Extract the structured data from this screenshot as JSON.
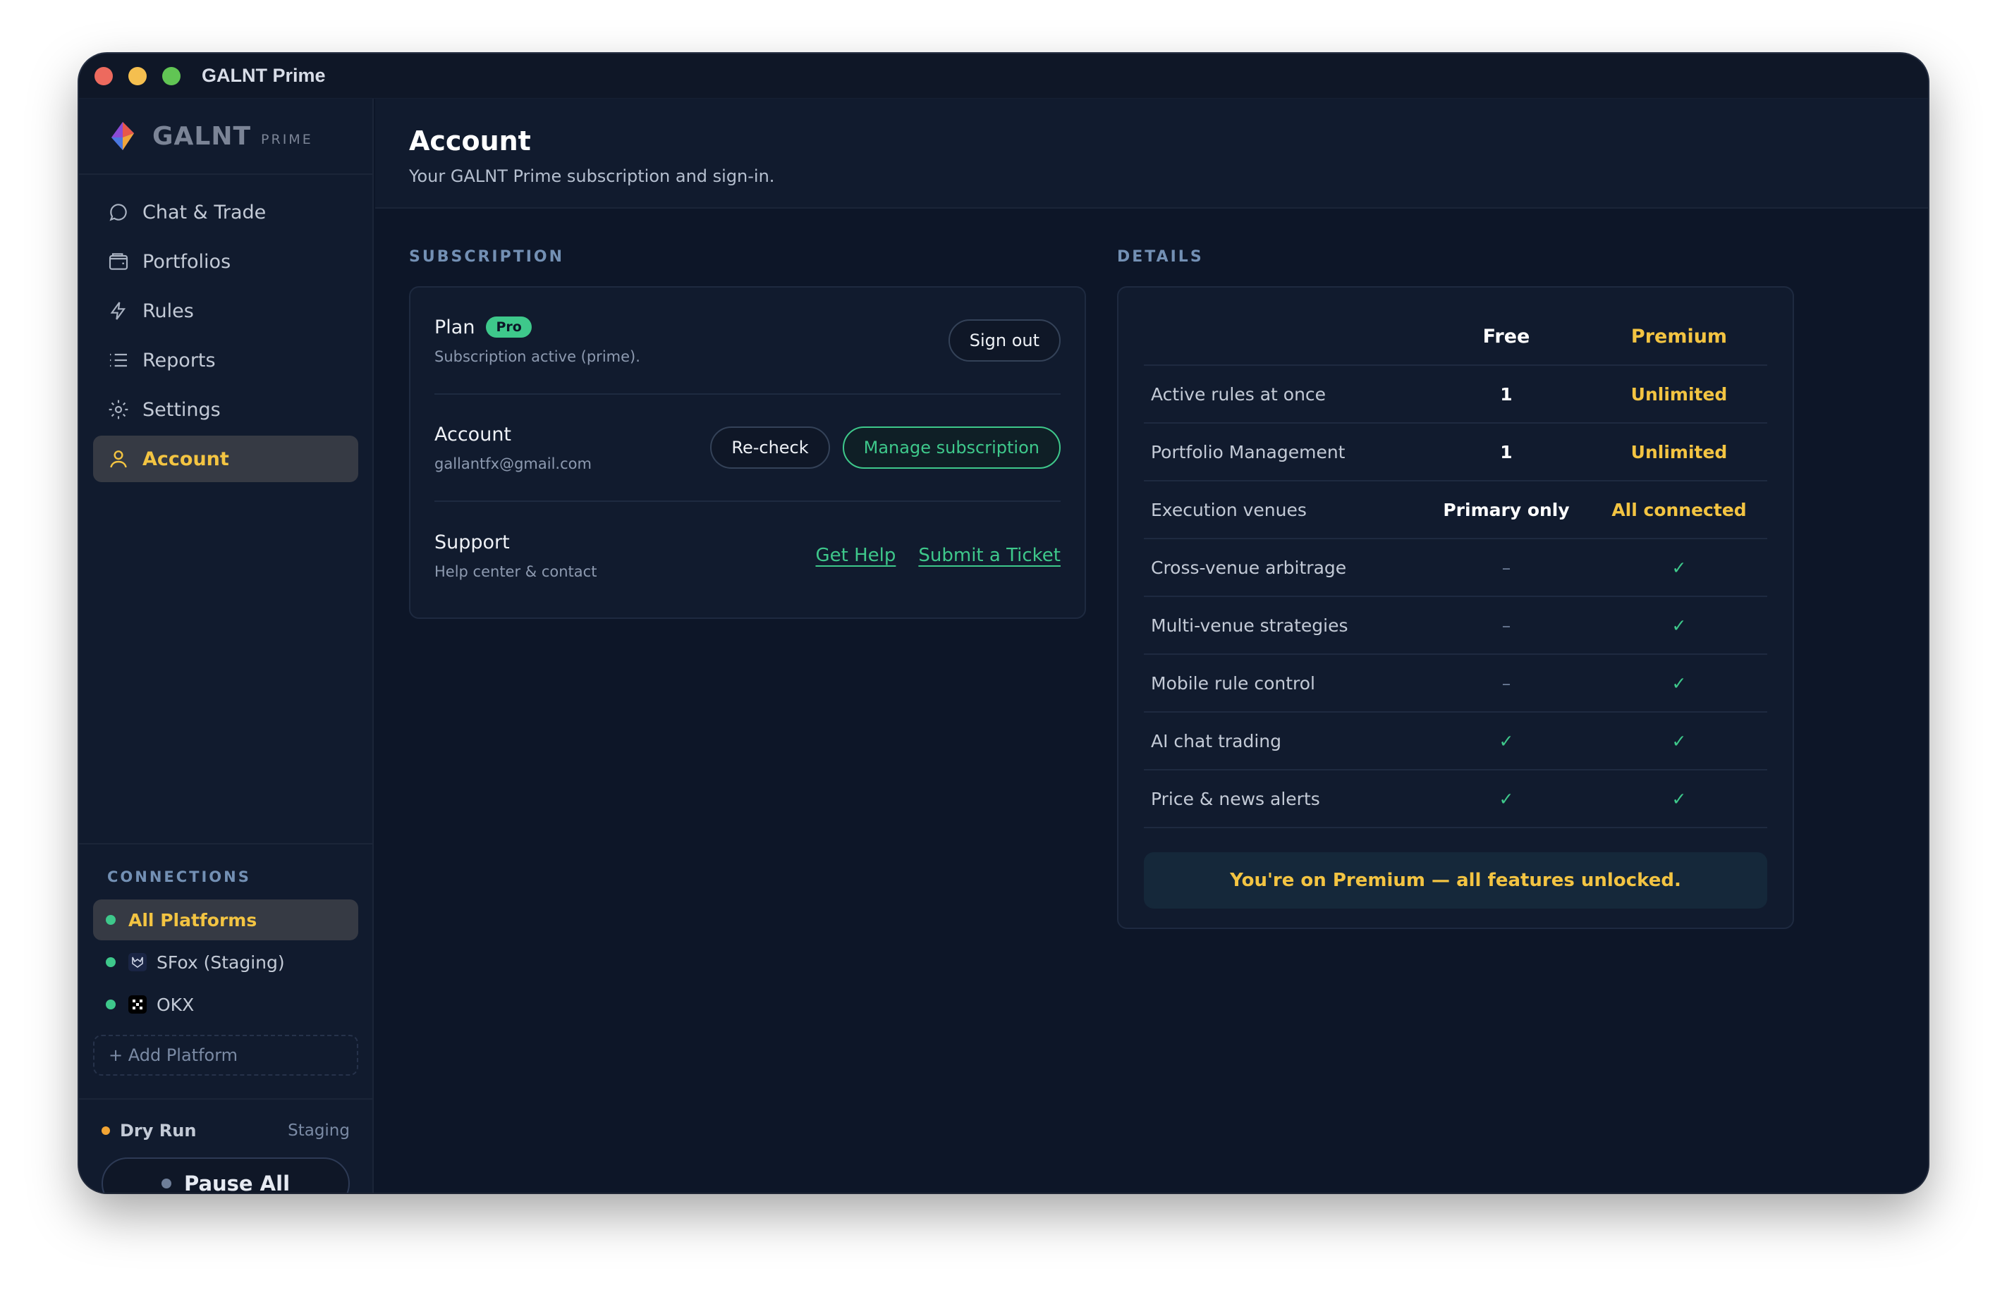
{
  "window": {
    "title": "GALNT Prime"
  },
  "brand": {
    "name": "GALNT",
    "sub": "PRIME"
  },
  "nav": [
    {
      "label": "Chat & Trade",
      "icon": "chat-icon"
    },
    {
      "label": "Portfolios",
      "icon": "wallet-icon"
    },
    {
      "label": "Rules",
      "icon": "bolt-icon"
    },
    {
      "label": "Reports",
      "icon": "list-icon"
    },
    {
      "label": "Settings",
      "icon": "gear-icon"
    },
    {
      "label": "Account",
      "icon": "user-icon",
      "active": true
    }
  ],
  "connections": {
    "label": "CONNECTIONS",
    "items": [
      {
        "label": "All Platforms",
        "active": true
      },
      {
        "label": "SFox (Staging)",
        "icon": "sfox-icon"
      },
      {
        "label": "OKX",
        "icon": "okx-icon"
      }
    ],
    "add_label": "+ Add Platform"
  },
  "status": {
    "mode": "Dry Run",
    "env": "Staging",
    "pause_label": "Pause All"
  },
  "header": {
    "title": "Account",
    "subtitle": "Your GALNT Prime subscription and sign-in."
  },
  "subscription": {
    "label": "SUBSCRIPTION",
    "plan": {
      "title": "Plan",
      "badge": "Pro",
      "desc": "Subscription active (prime).",
      "button": "Sign out"
    },
    "account": {
      "title": "Account",
      "email": "gallantfx@gmail.com",
      "recheck": "Re-check",
      "manage": "Manage subscription"
    },
    "support": {
      "title": "Support",
      "desc": "Help center & contact",
      "help": "Get Help",
      "ticket": "Submit a Ticket"
    }
  },
  "details": {
    "label": "DETAILS",
    "columns": {
      "free": "Free",
      "premium": "Premium"
    },
    "rows": [
      {
        "feature": "Active rules at once",
        "free": "1",
        "premium": "Unlimited"
      },
      {
        "feature": "Portfolio Management",
        "free": "1",
        "premium": "Unlimited"
      },
      {
        "feature": "Execution venues",
        "free": "Primary only",
        "premium": "All connected"
      },
      {
        "feature": "Cross-venue arbitrage",
        "free": "–",
        "premium": "✓"
      },
      {
        "feature": "Multi-venue strategies",
        "free": "–",
        "premium": "✓"
      },
      {
        "feature": "Mobile rule control",
        "free": "–",
        "premium": "✓"
      },
      {
        "feature": "AI chat trading",
        "free": "✓",
        "premium": "✓"
      },
      {
        "feature": "Price & news alerts",
        "free": "✓",
        "premium": "✓"
      }
    ],
    "banner": "You're on Premium — all features unlocked."
  },
  "colors": {
    "accent": "#f3c442",
    "green": "#3ec88b",
    "bg": "#0d1628"
  }
}
